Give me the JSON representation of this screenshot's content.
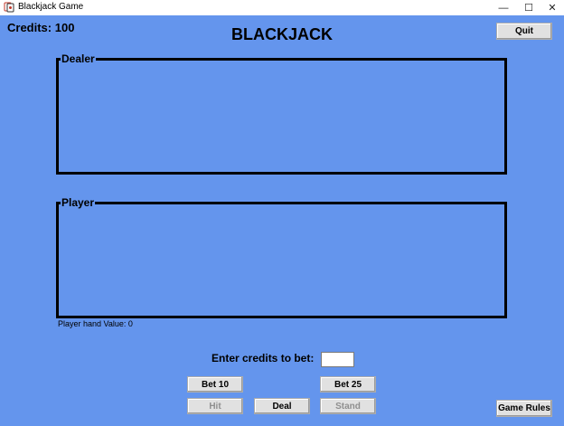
{
  "window": {
    "title": "Blackjack Game",
    "minimize_glyph": "—",
    "maximize_glyph": "☐",
    "close_glyph": "✕"
  },
  "header": {
    "credits_text": "Credits: 100",
    "game_title": "BLACKJACK",
    "quit_label": "Quit"
  },
  "dealer": {
    "label": "Dealer"
  },
  "player": {
    "label": "Player",
    "hand_value_text": "Player hand Value: 0"
  },
  "betting": {
    "prompt": "Enter credits to bet:",
    "input_value": "",
    "bet10_label": "Bet 10",
    "bet25_label": "Bet 25"
  },
  "actions": {
    "hit_label": "Hit",
    "deal_label": "Deal",
    "stand_label": "Stand",
    "hit_enabled": false,
    "stand_enabled": false
  },
  "footer": {
    "rules_label": "Game Rules"
  },
  "colors": {
    "table_background": "#6495ed",
    "border": "#000000"
  },
  "icons": {
    "app": "blackjack-app-icon"
  }
}
